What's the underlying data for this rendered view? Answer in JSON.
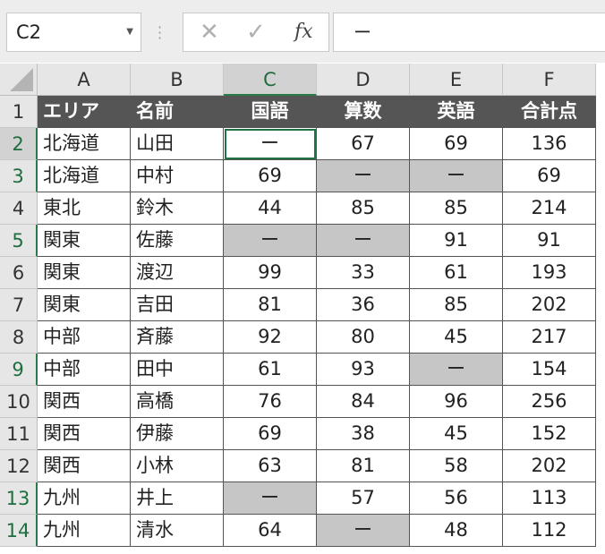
{
  "name_box": "C2",
  "formula_value": "ー",
  "column_headers": [
    "A",
    "B",
    "C",
    "D",
    "E",
    "F"
  ],
  "row_numbers": [
    "1",
    "2",
    "3",
    "4",
    "5",
    "6",
    "7",
    "8",
    "9",
    "10",
    "11",
    "12",
    "13",
    "14"
  ],
  "table_headers": [
    "エリア",
    "名前",
    "国語",
    "算数",
    "英語",
    "合計点"
  ],
  "rows": [
    [
      "北海道",
      "山田",
      "ー",
      "67",
      "69",
      "136"
    ],
    [
      "北海道",
      "中村",
      "69",
      "ー",
      "ー",
      "69"
    ],
    [
      "東北",
      "鈴木",
      "44",
      "85",
      "85",
      "214"
    ],
    [
      "関東",
      "佐藤",
      "ー",
      "ー",
      "91",
      "91"
    ],
    [
      "関東",
      "渡辺",
      "99",
      "33",
      "61",
      "193"
    ],
    [
      "関東",
      "吉田",
      "81",
      "36",
      "85",
      "202"
    ],
    [
      "中部",
      "斉藤",
      "92",
      "80",
      "45",
      "217"
    ],
    [
      "中部",
      "田中",
      "61",
      "93",
      "ー",
      "154"
    ],
    [
      "関西",
      "高橋",
      "76",
      "84",
      "96",
      "256"
    ],
    [
      "関西",
      "伊藤",
      "69",
      "38",
      "45",
      "152"
    ],
    [
      "関西",
      "小林",
      "63",
      "81",
      "58",
      "202"
    ],
    [
      "九州",
      "井上",
      "ー",
      "57",
      "56",
      "113"
    ],
    [
      "九州",
      "清水",
      "64",
      "ー",
      "48",
      "112"
    ]
  ],
  "colors": {
    "header_fill": "#555555",
    "blank_fill": "#c6c6c6",
    "selection": "#217346"
  },
  "icons": [
    "x-icon",
    "check-icon",
    "fx-icon"
  ]
}
